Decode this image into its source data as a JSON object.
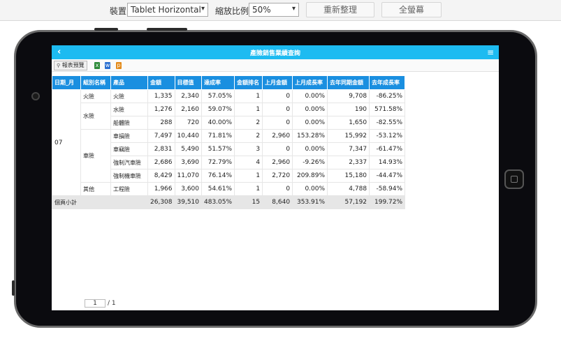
{
  "toolbar": {
    "device_label": "裝置",
    "device_value": "Tablet Horizontal",
    "zoom_label": "縮放比例",
    "zoom_value": "50%",
    "reset_button": "重新整理",
    "fullscreen_button": "全螢幕"
  },
  "app": {
    "title": "產險銷售業績查詢",
    "back_icon": "‹",
    "menu_icon": "≡"
  },
  "report_toolbar": {
    "preview_label": "報表預覽"
  },
  "table": {
    "headers": [
      "日期_月",
      "組別名稱",
      "產品",
      "金額",
      "目標值",
      "達成率",
      "金額排名",
      "上月金額",
      "上月成長率",
      "去年同期金額",
      "去年成長率"
    ],
    "month": "07",
    "groups": [
      {
        "name": "火險",
        "rows": [
          {
            "product": "火險",
            "amount": "1,335",
            "target": "2,340",
            "rate": "57.05%",
            "rank": "1",
            "last_month": "0",
            "mom": "0.00%",
            "last_year": "9,708",
            "yoy": "-86.25%"
          }
        ]
      },
      {
        "name": "水險",
        "rows": [
          {
            "product": "水險",
            "amount": "1,276",
            "target": "2,160",
            "rate": "59.07%",
            "rank": "1",
            "last_month": "0",
            "mom": "0.00%",
            "last_year": "190",
            "yoy": "571.58%"
          },
          {
            "product": "船體險",
            "amount": "288",
            "target": "720",
            "rate": "40.00%",
            "rank": "2",
            "last_month": "0",
            "mom": "0.00%",
            "last_year": "1,650",
            "yoy": "-82.55%"
          }
        ]
      },
      {
        "name": "車險",
        "rows": [
          {
            "product": "車損險",
            "amount": "7,497",
            "target": "10,440",
            "rate": "71.81%",
            "rank": "2",
            "last_month": "2,960",
            "mom": "153.28%",
            "last_year": "15,992",
            "yoy": "-53.12%"
          },
          {
            "product": "車竊險",
            "amount": "2,831",
            "target": "5,490",
            "rate": "51.57%",
            "rank": "3",
            "last_month": "0",
            "mom": "0.00%",
            "last_year": "7,347",
            "yoy": "-61.47%"
          },
          {
            "product": "強制汽車險",
            "amount": "2,686",
            "target": "3,690",
            "rate": "72.79%",
            "rank": "4",
            "last_month": "2,960",
            "mom": "-9.26%",
            "last_year": "2,337",
            "yoy": "14.93%"
          },
          {
            "product": "強制機車險",
            "amount": "8,429",
            "target": "11,070",
            "rate": "76.14%",
            "rank": "1",
            "last_month": "2,720",
            "mom": "209.89%",
            "last_year": "15,180",
            "yoy": "-44.47%"
          }
        ]
      },
      {
        "name": "其他",
        "rows": [
          {
            "product": "工程險",
            "amount": "1,966",
            "target": "3,600",
            "rate": "54.61%",
            "rank": "1",
            "last_month": "0",
            "mom": "0.00%",
            "last_year": "4,788",
            "yoy": "-58.94%"
          }
        ]
      }
    ],
    "subtotal": {
      "label": "個頁小計",
      "amount": "26,308",
      "target": "39,510",
      "rate": "483.05%",
      "rank": "15",
      "last_month": "8,640",
      "mom": "353.91%",
      "last_year": "57,192",
      "yoy": "199.72%"
    }
  },
  "pager": {
    "current": "1",
    "total": "/ 1"
  }
}
